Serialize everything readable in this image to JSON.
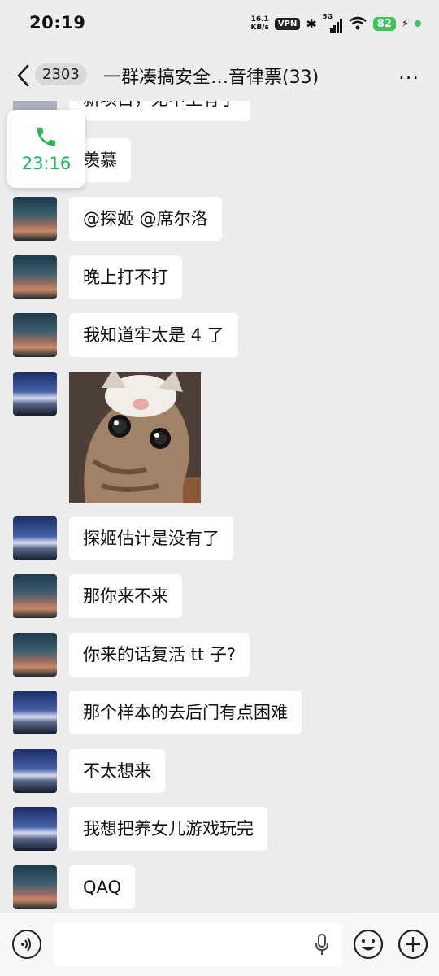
{
  "status": {
    "time": "20:19",
    "net_speed": "16.1",
    "net_unit": "KB/s",
    "vpn": "VPN",
    "signal": "5G",
    "battery": "82"
  },
  "header": {
    "unread_count": "2303",
    "title": "一群凑搞安全…音律票(33)",
    "more": "···"
  },
  "call": {
    "duration": "23:16"
  },
  "messages": [
    {
      "type": "text",
      "text": "新项目，无中生有了",
      "avatar": "pale"
    },
    {
      "type": "text",
      "text": "羡慕",
      "avatar": "sunset"
    },
    {
      "type": "text",
      "text": "@探姬 @席尔洛",
      "avatar": "sunset"
    },
    {
      "type": "text",
      "text": "晚上打不打",
      "avatar": "sunset"
    },
    {
      "type": "text",
      "text": "我知道牢太是 4 了",
      "avatar": "sunset"
    },
    {
      "type": "image",
      "avatar": "night"
    },
    {
      "type": "text",
      "text": "探姬估计是没有了",
      "avatar": "night"
    },
    {
      "type": "text",
      "text": "那你来不来",
      "avatar": "sunset"
    },
    {
      "type": "text",
      "text": "你来的话复活 tt 子?",
      "avatar": "sunset"
    },
    {
      "type": "text",
      "text": "那个样本的去后门有点困难",
      "avatar": "night"
    },
    {
      "type": "text",
      "text": "不太想来",
      "avatar": "night"
    },
    {
      "type": "text",
      "text": "我想把养女儿游戏玩完",
      "avatar": "night"
    },
    {
      "type": "text",
      "text": "QAQ",
      "avatar": "sunset"
    }
  ],
  "colors": {
    "background": "#ededed",
    "bubble": "#ffffff",
    "call_green": "#26b35a",
    "battery_green": "#3cc55d"
  },
  "icons": [
    "back-chevron-icon",
    "more-icon",
    "phone-icon",
    "voice-icon",
    "microphone-icon",
    "emoji-icon",
    "plus-icon"
  ]
}
